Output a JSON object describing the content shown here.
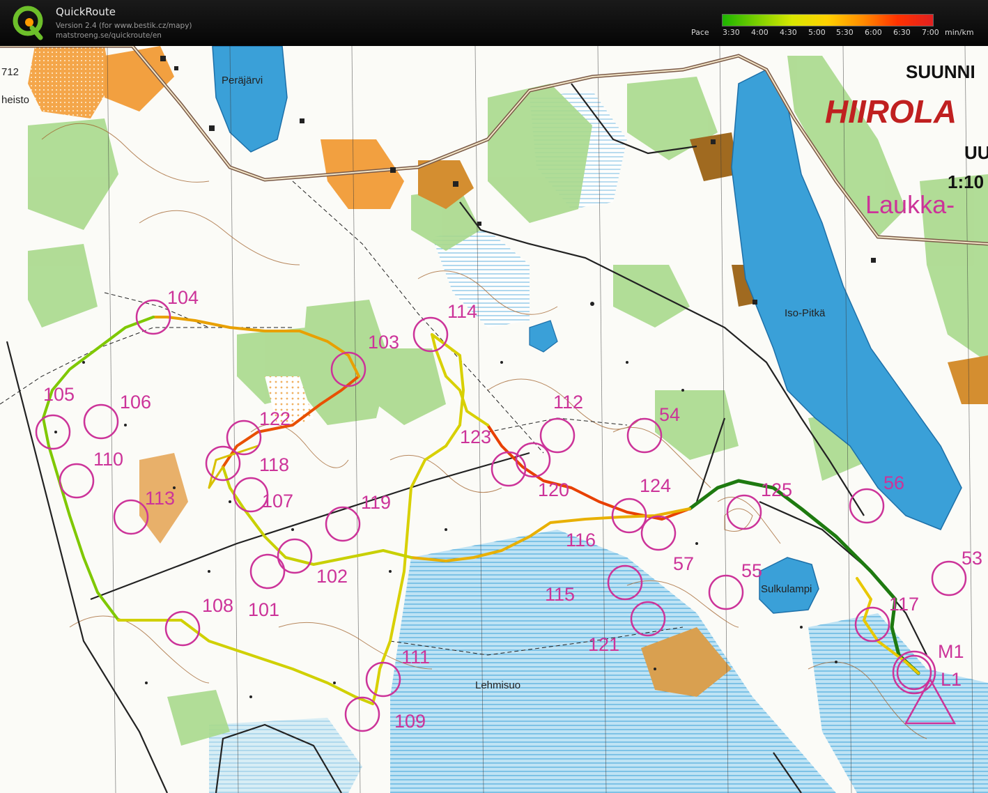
{
  "app": {
    "title": "QuickRoute",
    "version_line": "Version 2.4  (for www.bestik.cz/mapy)",
    "url_line": "matstroeng.se/quickroute/en"
  },
  "pace_legend": {
    "label": "Pace",
    "ticks": [
      "3:30",
      "4:00",
      "4:30",
      "5:00",
      "5:30",
      "6:00",
      "6:30",
      "7:00"
    ],
    "unit": "min/km",
    "colors": [
      "#1db400",
      "#7ed000",
      "#d8e600",
      "#ffd000",
      "#ff8a00",
      "#ff3300",
      "#e02020"
    ]
  },
  "map": {
    "title_texts": [
      "SUUNNI",
      "HIIROLA",
      "UU",
      "1:10",
      "Laukka-"
    ],
    "place_names": [
      {
        "id": "perajarvi",
        "text": "Peräjärvi"
      },
      {
        "id": "iso-pitka",
        "text": "Iso-Pitkä"
      },
      {
        "id": "sulkulampi",
        "text": "Sulkulampi"
      },
      {
        "id": "lehmisuo",
        "text": "Lehmisuo"
      },
      {
        "id": "heisto",
        "text": "heisto"
      },
      {
        "id": "left-712",
        "text": "712"
      }
    ],
    "controls": [
      {
        "label": "104"
      },
      {
        "label": "103"
      },
      {
        "label": "114"
      },
      {
        "label": "105"
      },
      {
        "label": "106"
      },
      {
        "label": "110"
      },
      {
        "label": "122"
      },
      {
        "label": "118"
      },
      {
        "label": "113"
      },
      {
        "label": "107"
      },
      {
        "label": "119"
      },
      {
        "label": "102"
      },
      {
        "label": "101"
      },
      {
        "label": "108"
      },
      {
        "label": "111"
      },
      {
        "label": "109"
      },
      {
        "label": "123"
      },
      {
        "label": "112"
      },
      {
        "label": "120"
      },
      {
        "label": "54"
      },
      {
        "label": "124"
      },
      {
        "label": "116"
      },
      {
        "label": "125"
      },
      {
        "label": "56"
      },
      {
        "label": "57"
      },
      {
        "label": "55"
      },
      {
        "label": "115"
      },
      {
        "label": "121"
      },
      {
        "label": "117"
      },
      {
        "label": "53"
      },
      {
        "label": "M1"
      },
      {
        "label": "L1"
      }
    ]
  }
}
